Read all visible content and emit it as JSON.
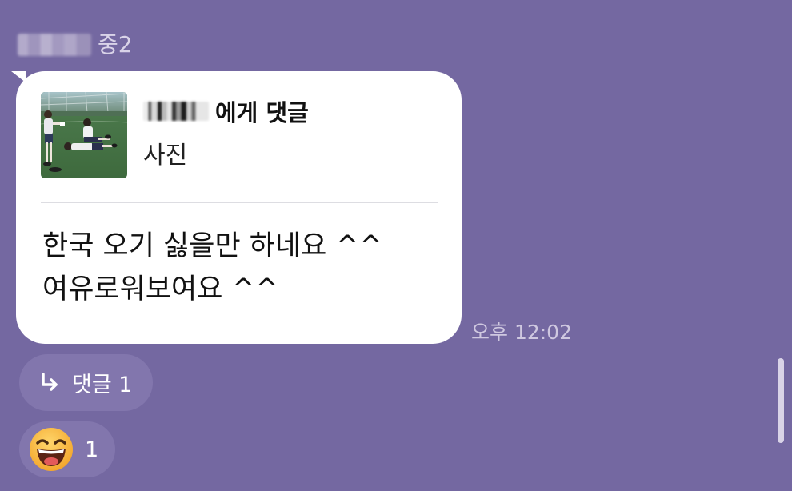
{
  "sender": {
    "name_suffix": "중2"
  },
  "message": {
    "reply_target_suffix": "에게 댓글",
    "reply_type": "사진",
    "lines": [
      "한국 오기 싫을만 하네요 ^^",
      "여유로워보여요 ^^"
    ],
    "time": "오후 12:02"
  },
  "comment": {
    "label": "댓글 1",
    "icon": "reply-arrow-icon"
  },
  "reaction": {
    "emoji": "grinning-face-icon",
    "count": "1"
  },
  "colors": {
    "background": "#7468a1",
    "pill": "#8276ad",
    "bubble": "#ffffff"
  }
}
